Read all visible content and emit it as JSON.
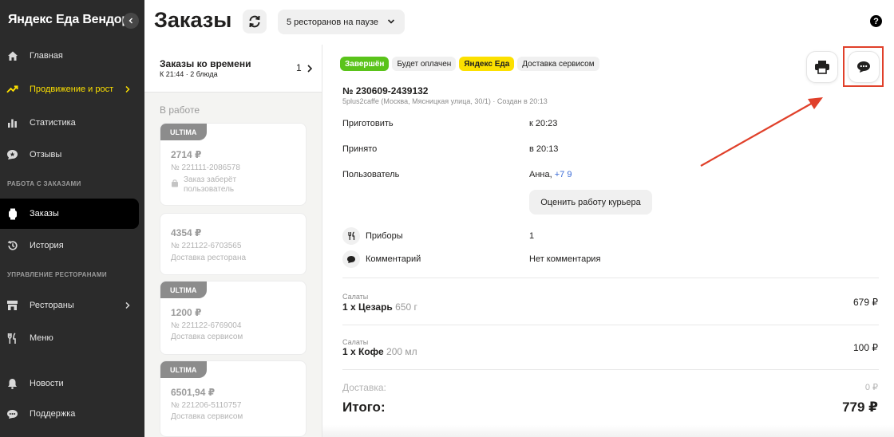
{
  "sidebar": {
    "brand": "Яндекс Еда Вендор",
    "items": [
      {
        "label": "Главная"
      },
      {
        "label": "Продвижение и рост"
      },
      {
        "label": "Статистика"
      },
      {
        "label": "Отзывы"
      },
      {
        "label": "Заказы"
      },
      {
        "label": "История"
      },
      {
        "label": "Рестораны"
      },
      {
        "label": "Меню"
      },
      {
        "label": "Новости"
      },
      {
        "label": "Поддержка"
      }
    ],
    "sections": [
      "РАБОТА С ЗАКАЗАМИ",
      "УПРАВЛЕНИЕ РЕСТОРАНАМИ"
    ],
    "active_item": "Заказы",
    "accent_color": "#fce000"
  },
  "header": {
    "title": "Заказы",
    "pause_button": "5 ресторанов на паузе",
    "help": "?"
  },
  "order_list": {
    "header_title": "Заказы ко времени",
    "header_subtitle": "К 21:44 · 2 блюда",
    "header_count": "1",
    "section_label": "В работе",
    "cards": [
      {
        "tag": "ULTIMA",
        "price": "2714 ₽",
        "number": "№ 221111-2086578",
        "note": "Заказ заберёт пользователь"
      },
      {
        "tag": "",
        "price": "4354 ₽",
        "number": "№ 221122-6703565",
        "note": "Доставка ресторана"
      },
      {
        "tag": "ULTIMA",
        "price": "1200 ₽",
        "number": "№ 221122-6769004",
        "note": "Доставка сервисом"
      },
      {
        "tag": "ULTIMA",
        "price": "6501,94 ₽",
        "number": "№ 221206-5110757",
        "note": "Доставка сервисом"
      }
    ]
  },
  "order": {
    "badges": [
      "Завершён",
      "Будет оплачен",
      "Яндекс Еда",
      "Доставка сервисом"
    ],
    "number": "№ 230609-2439132",
    "meta": "5plus2caffe (Москва, Мясницкая улица, 30/1) · Создан в 20:13",
    "fields": [
      {
        "label": "Приготовить",
        "value": "к 20:23"
      },
      {
        "label": "Принято",
        "value": "в 20:13"
      },
      {
        "label": "Пользователь",
        "value": "Анна,",
        "phone": "+7 9"
      }
    ],
    "rate_courier": "Оценить работу курьера",
    "cutlery_label": "Приборы",
    "cutlery_value": "1",
    "comment_label": "Комментарий",
    "comment_value": "Нет комментария",
    "items": [
      {
        "category": "Салаты",
        "name": "1 x Цезарь",
        "weight": "650 г",
        "price": "679 ₽"
      },
      {
        "category": "Салаты",
        "name": "1 x Кофе",
        "weight": "200 мл",
        "price": "100 ₽"
      }
    ],
    "delivery_label": "Доставка:",
    "delivery_value": "0 ₽",
    "total_label": "Итого:",
    "total_value": "779 ₽",
    "status_color": "#5ac31a",
    "annotation_color": "#e0402a"
  }
}
